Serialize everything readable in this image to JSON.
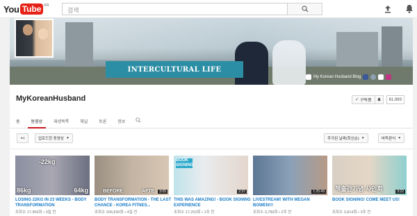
{
  "masthead": {
    "logo_you": "You",
    "logo_tube": "Tube",
    "logo_region": "KR",
    "search_placeholder": "검색",
    "icons": [
      "search-icon",
      "upload-icon",
      "bell-icon"
    ]
  },
  "banner": {
    "title": "INTERCULTURAL LIFE",
    "blog_label": "My Korean Husband Blog"
  },
  "channel": {
    "name": "MyKoreanHusband",
    "subscribe_label": "구독중",
    "subscriber_count": "61,969",
    "tabs": [
      {
        "label": "홈",
        "active": false
      },
      {
        "label": "동영상",
        "active": true
      },
      {
        "label": "재생목록",
        "active": false
      },
      {
        "label": "채널",
        "active": false
      },
      {
        "label": "토론",
        "active": false
      },
      {
        "label": "정보",
        "active": false
      }
    ]
  },
  "toolbar": {
    "back_label": "↤",
    "uploads_label": "업로드한 동영상",
    "sort_label": "추가된 날짜(최신순)",
    "view_label": "바둑판식"
  },
  "videos": [
    {
      "title": "LOSING 22KG IN 23 WEEKS - BODY TRANSFORMATION",
      "meta": "조회수 17,956회 • 3일 전",
      "duration": "",
      "overlay_top": "-22kg",
      "overlay_left": "86kg",
      "overlay_right": "64kg"
    },
    {
      "title": "BODY TRANSFORMATION - THE LAST CHANCE - KOREA FITNES...",
      "meta": "조회수 206,830회 • 4일 전",
      "duration": "3:05",
      "overlay_left": "BEFORE",
      "overlay_right": "AFTE"
    },
    {
      "title": "THIS WAS AMAZING! - BOOK SIGNING EXPERIENCE",
      "meta": "조회수 17,253회 • 1주 전",
      "duration": "2:37",
      "overlay_top": "BOOK SIGNING"
    },
    {
      "title": "LIVESTREAM! WITH MEGAN BOWEN!!!",
      "meta": "조회수 3,789회 • 2주 전",
      "duration": "1:25:49"
    },
    {
      "title": "BOOK SIGNING! COME MEET US!",
      "meta": "조회수 3,814회 • 3주 전",
      "duration": "3:22",
      "overlay_bottom": "책출간기념 사인회"
    }
  ]
}
